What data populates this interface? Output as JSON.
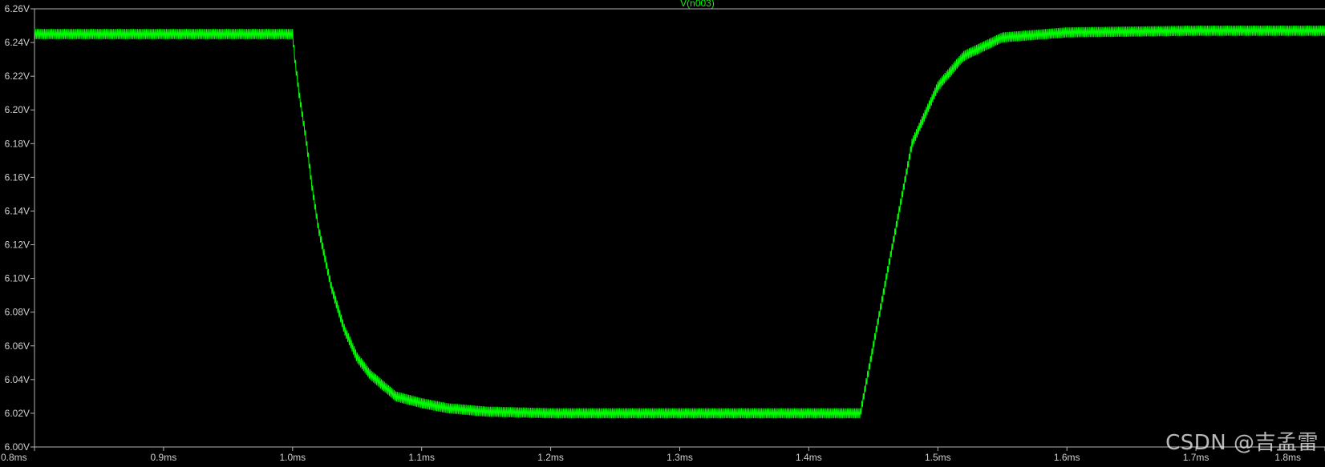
{
  "chart_data": {
    "type": "line",
    "title": "V(n003)",
    "xlabel": "",
    "ylabel": "",
    "xlim": [
      0.8,
      1.8
    ],
    "ylim": [
      6.0,
      6.26
    ],
    "x_unit": "ms",
    "y_unit": "V",
    "x_ticks": [
      0.8,
      0.9,
      1.0,
      1.1,
      1.2,
      1.3,
      1.4,
      1.5,
      1.6,
      1.7,
      1.8
    ],
    "x_tick_labels": [
      "0.8ms",
      "0.9ms",
      "1.0ms",
      "1.1ms",
      "1.2ms",
      "1.3ms",
      "1.4ms",
      "1.5ms",
      "1.6ms",
      "1.7ms",
      "1.8ms"
    ],
    "y_ticks": [
      6.0,
      6.02,
      6.04,
      6.06,
      6.08,
      6.1,
      6.12,
      6.14,
      6.16,
      6.18,
      6.2,
      6.22,
      6.24,
      6.26
    ],
    "y_tick_labels": [
      "6.00V",
      "6.02V",
      "6.04V",
      "6.06V",
      "6.08V",
      "6.10V",
      "6.12V",
      "6.14V",
      "6.16V",
      "6.18V",
      "6.20V",
      "6.22V",
      "6.24V",
      "6.26V"
    ],
    "grid": false,
    "series": [
      {
        "name": "V(n003)",
        "x": [
          0.8,
          0.9,
          1.0,
          1.002,
          1.005,
          1.01,
          1.015,
          1.02,
          1.03,
          1.04,
          1.05,
          1.06,
          1.08,
          1.1,
          1.12,
          1.15,
          1.2,
          1.3,
          1.4,
          1.44,
          1.45,
          1.46,
          1.47,
          1.48,
          1.5,
          1.52,
          1.55,
          1.6,
          1.7,
          1.8
        ],
        "y": [
          6.245,
          6.245,
          6.245,
          6.228,
          6.21,
          6.185,
          6.155,
          6.13,
          6.095,
          6.07,
          6.053,
          6.043,
          6.03,
          6.026,
          6.023,
          6.021,
          6.02,
          6.02,
          6.02,
          6.02,
          6.06,
          6.1,
          6.14,
          6.18,
          6.214,
          6.232,
          6.243,
          6.246,
          6.247,
          6.247
        ],
        "ripple_amplitude": 0.003,
        "color": "#00ff00"
      }
    ],
    "colors": {
      "background": "#000000",
      "trace": "#00ff00",
      "axis": "#b4b4b4",
      "labels": "#d0d0d0",
      "title": "#00ff00"
    }
  },
  "watermark": "CSDN @吉孟雷"
}
